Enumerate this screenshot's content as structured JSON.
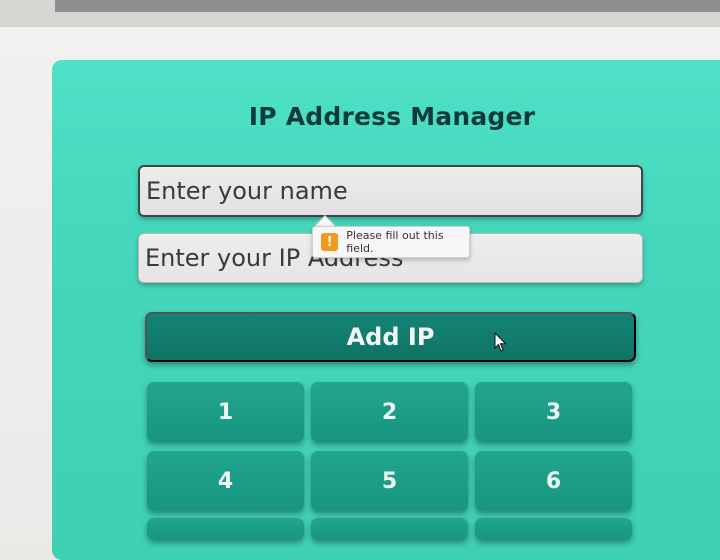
{
  "app": {
    "title": "IP Address Manager"
  },
  "form": {
    "name_placeholder": "Enter your name",
    "ip_placeholder": "Enter your IP Address",
    "validation_message": "Please fill out this field.",
    "add_label": "Add IP"
  },
  "keypad": {
    "keys": [
      "1",
      "2",
      "3",
      "4",
      "5",
      "6"
    ]
  },
  "colors": {
    "card_background": "#45d8bc",
    "primary_button": "#137c6e",
    "key_button": "#1c9d87",
    "warning": "#f39a1d"
  },
  "icons": {
    "validation": "warning-icon",
    "pointer": "mouse-cursor-icon"
  }
}
